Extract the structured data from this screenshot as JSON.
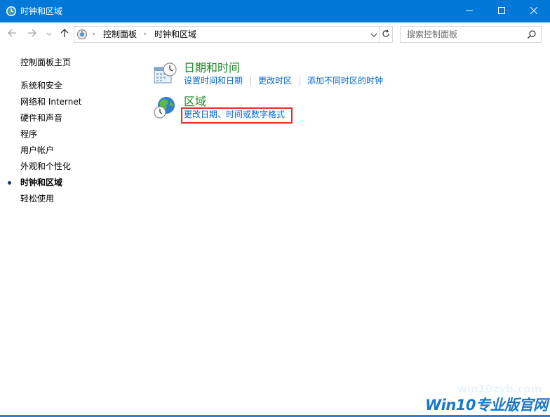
{
  "window": {
    "title": "时钟和区域",
    "app_icon": "clock-globe-icon",
    "buttons": {
      "minimize": "minimize-icon",
      "maximize": "maximize-icon",
      "close": "close-icon"
    },
    "accent_color": "#0078d7"
  },
  "navigation": {
    "back": "arrow-left-icon",
    "forward": "arrow-right-icon",
    "recent": "chevron-down-icon",
    "up": "arrow-up-icon"
  },
  "address": {
    "location_icon": "control-panel-icon",
    "breadcrumbs": [
      "控制面板",
      "时钟和区域"
    ],
    "separator": "›",
    "dropdown": "chevron-down-icon",
    "refresh": "refresh-icon"
  },
  "search": {
    "placeholder": "搜索控制面板",
    "icon": "search-icon"
  },
  "sidebar": {
    "home": "控制面板主页",
    "items": [
      {
        "label": "系统和安全"
      },
      {
        "label": "网络和 Internet"
      },
      {
        "label": "硬件和声音"
      },
      {
        "label": "程序"
      },
      {
        "label": "用户帐户"
      },
      {
        "label": "外观和个性化"
      },
      {
        "label": "时钟和区域",
        "current": true
      },
      {
        "label": "轻松使用"
      }
    ]
  },
  "categories": [
    {
      "title": "日期和时间",
      "icon": "calendar-clock-icon",
      "links": [
        "设置时间和日期",
        "更改时区",
        "添加不同时区的时钟"
      ]
    },
    {
      "title": "区域",
      "icon": "globe-clock-icon",
      "links": [
        "更改日期、时间或数字格式"
      ]
    }
  ],
  "colors": {
    "category_title": "#1e8a28",
    "link": "#0066cc",
    "highlight_box": "#e0312a"
  },
  "watermark": {
    "url": "win10zyb.com",
    "brand": "Win10专业版官网"
  }
}
